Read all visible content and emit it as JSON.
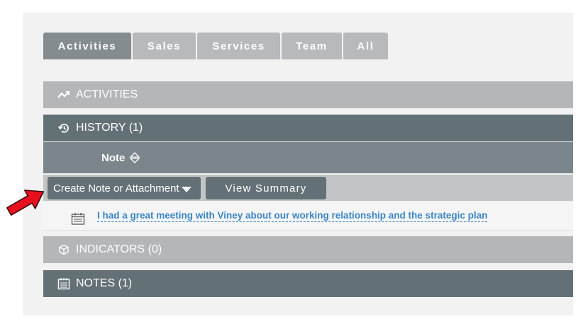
{
  "tabs": [
    "Activities",
    "Sales",
    "Services",
    "Team",
    "All"
  ],
  "active_tab": "Activities",
  "sections": {
    "activities": "ACTIVITIES",
    "history": "HISTORY (1)",
    "indicators": "INDICATORS (0)",
    "notes": "NOTES (1)"
  },
  "history_table": {
    "column_header": "Note",
    "create_button": "Create Note or Attachment",
    "view_summary_button": "View Summary",
    "items": [
      {
        "text": "I had a great meeting with Viney about our working relationship and the strategic plan",
        "icon": "calendar-icon"
      }
    ]
  },
  "colors": {
    "dark_bar": "#637177",
    "light_bar": "#b4b6b7",
    "link": "#3a86c8",
    "callout_arrow": "#e8101e"
  }
}
